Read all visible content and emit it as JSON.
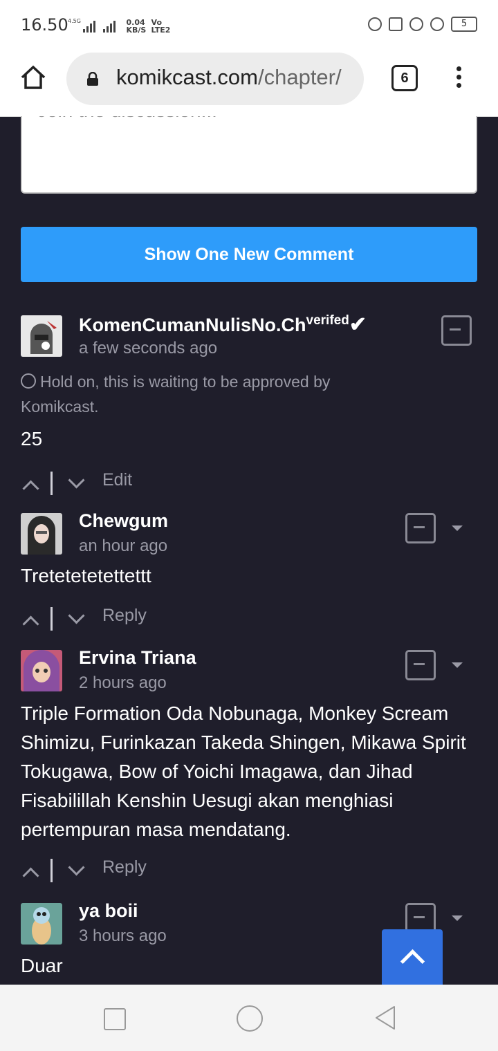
{
  "status_bar": {
    "time": "16.50",
    "network_type": "4.5G",
    "speed_value": "0.04",
    "speed_unit": "KB/S",
    "volte": "Vo",
    "lte": "LTE2",
    "battery": "5"
  },
  "browser": {
    "url_domain": "komikcast.com",
    "url_path": "/chapter/",
    "tab_count": "6"
  },
  "comment_form": {
    "placeholder": "Join the discussion..."
  },
  "new_comment_button": "Show One New Comment",
  "comments": [
    {
      "author": "KomenCumanNulisNo.Ch",
      "badge": "verifed",
      "badge_mark": "✔",
      "time": "a few seconds ago",
      "pending": "Hold on, this is waiting to be approved by Komikcast.",
      "body": "25",
      "action": "Edit"
    },
    {
      "author": "Chewgum",
      "time": "an hour ago",
      "body": "Tretetetetettettt",
      "action": "Reply"
    },
    {
      "author": "Ervina Triana",
      "time": "2 hours ago",
      "body": "Triple Formation Oda Nobunaga, Monkey Scream Shimizu, Furinkazan Takeda Shingen, Mikawa Spirit Tokugawa, Bow of Yoichi Imagawa, dan Jihad Fisabilillah Kenshin Uesugi akan menghiasi pertempuran masa mendatang.",
      "action": "Reply"
    },
    {
      "author": "ya boii",
      "time": "3 hours ago",
      "body": "Duar"
    }
  ],
  "colors": {
    "background": "#1f1e2b",
    "accent_button": "#2e9cfa",
    "scroll_top_button": "#3170e0",
    "muted_text": "#9a9aa6"
  }
}
